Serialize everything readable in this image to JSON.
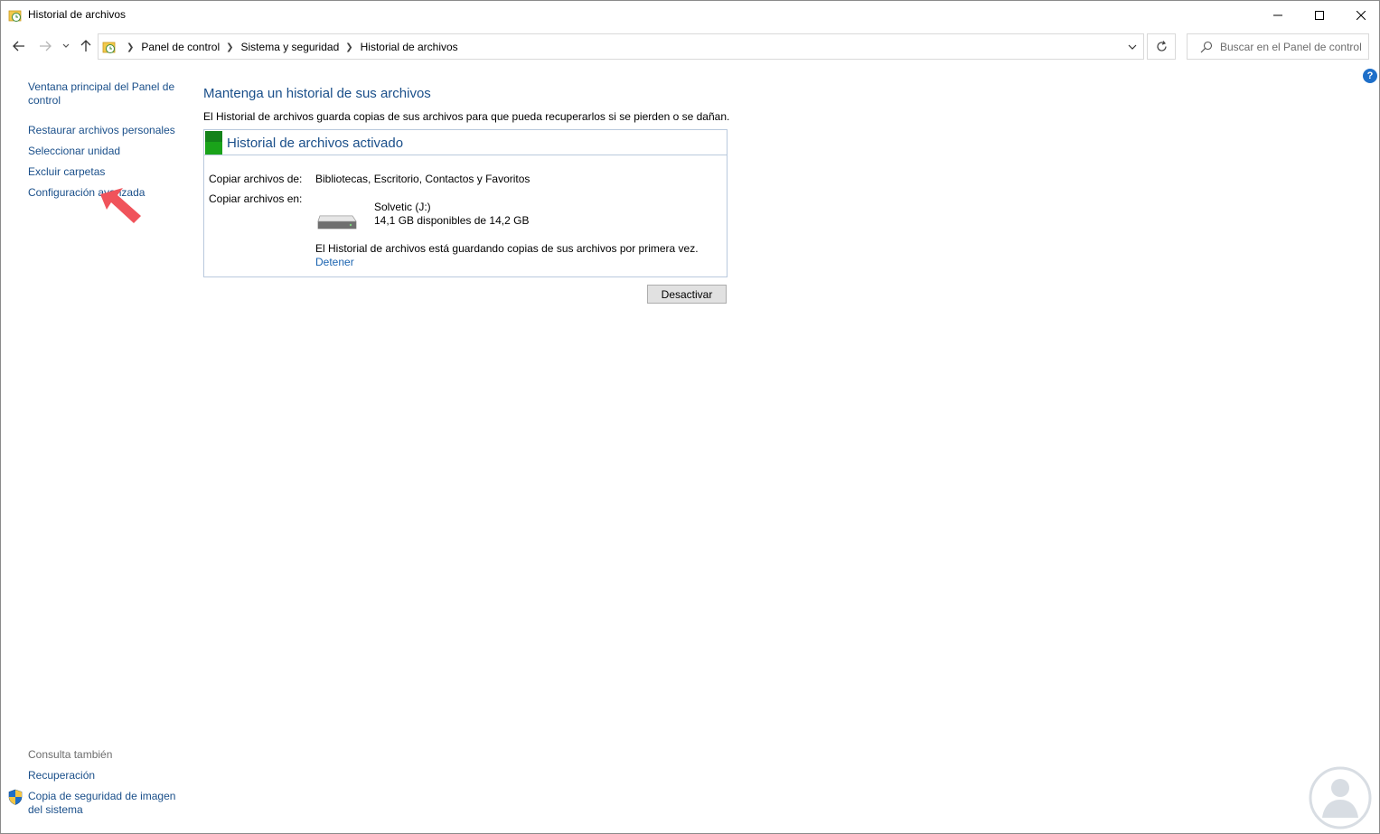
{
  "window": {
    "title": "Historial de archivos"
  },
  "address_bar": {
    "breadcrumbs": [
      "Panel de control",
      "Sistema y seguridad",
      "Historial de archivos"
    ]
  },
  "search": {
    "placeholder": "Buscar en el Panel de control"
  },
  "sidebar": {
    "items": [
      {
        "label": "Ventana principal del Panel de control"
      },
      {
        "label": "Restaurar archivos personales"
      },
      {
        "label": "Seleccionar unidad"
      },
      {
        "label": "Excluir carpetas"
      },
      {
        "label": "Configuración avanzada"
      }
    ],
    "see_also_title": "Consulta también",
    "see_also": [
      {
        "label": "Recuperación"
      },
      {
        "label": "Copia de seguridad de imagen del sistema"
      }
    ]
  },
  "main": {
    "heading": "Mantenga un historial de sus archivos",
    "description": "El Historial de archivos guarda copias de sus archivos para que pueda recuperarlos si se pierden o se dañan.",
    "panel": {
      "title": "Historial de archivos activado",
      "copy_from_label": "Copiar archivos de:",
      "copy_from_value": "Bibliotecas, Escritorio, Contactos y Favoritos",
      "copy_to_label": "Copiar archivos en:",
      "drive_name": "Solvetic (J:)",
      "drive_space": "14,1 GB disponibles de 14,2 GB",
      "status_message": "El Historial de archivos está guardando copias de sus archivos por primera vez.",
      "stop_link": "Detener"
    },
    "deactivate_button": "Desactivar"
  },
  "colors": {
    "link": "#1a4f8a",
    "heading": "#1a4f8a",
    "status_green": "#1aa31a",
    "arrow": "#f0535b",
    "help": "#1e6fc9"
  }
}
